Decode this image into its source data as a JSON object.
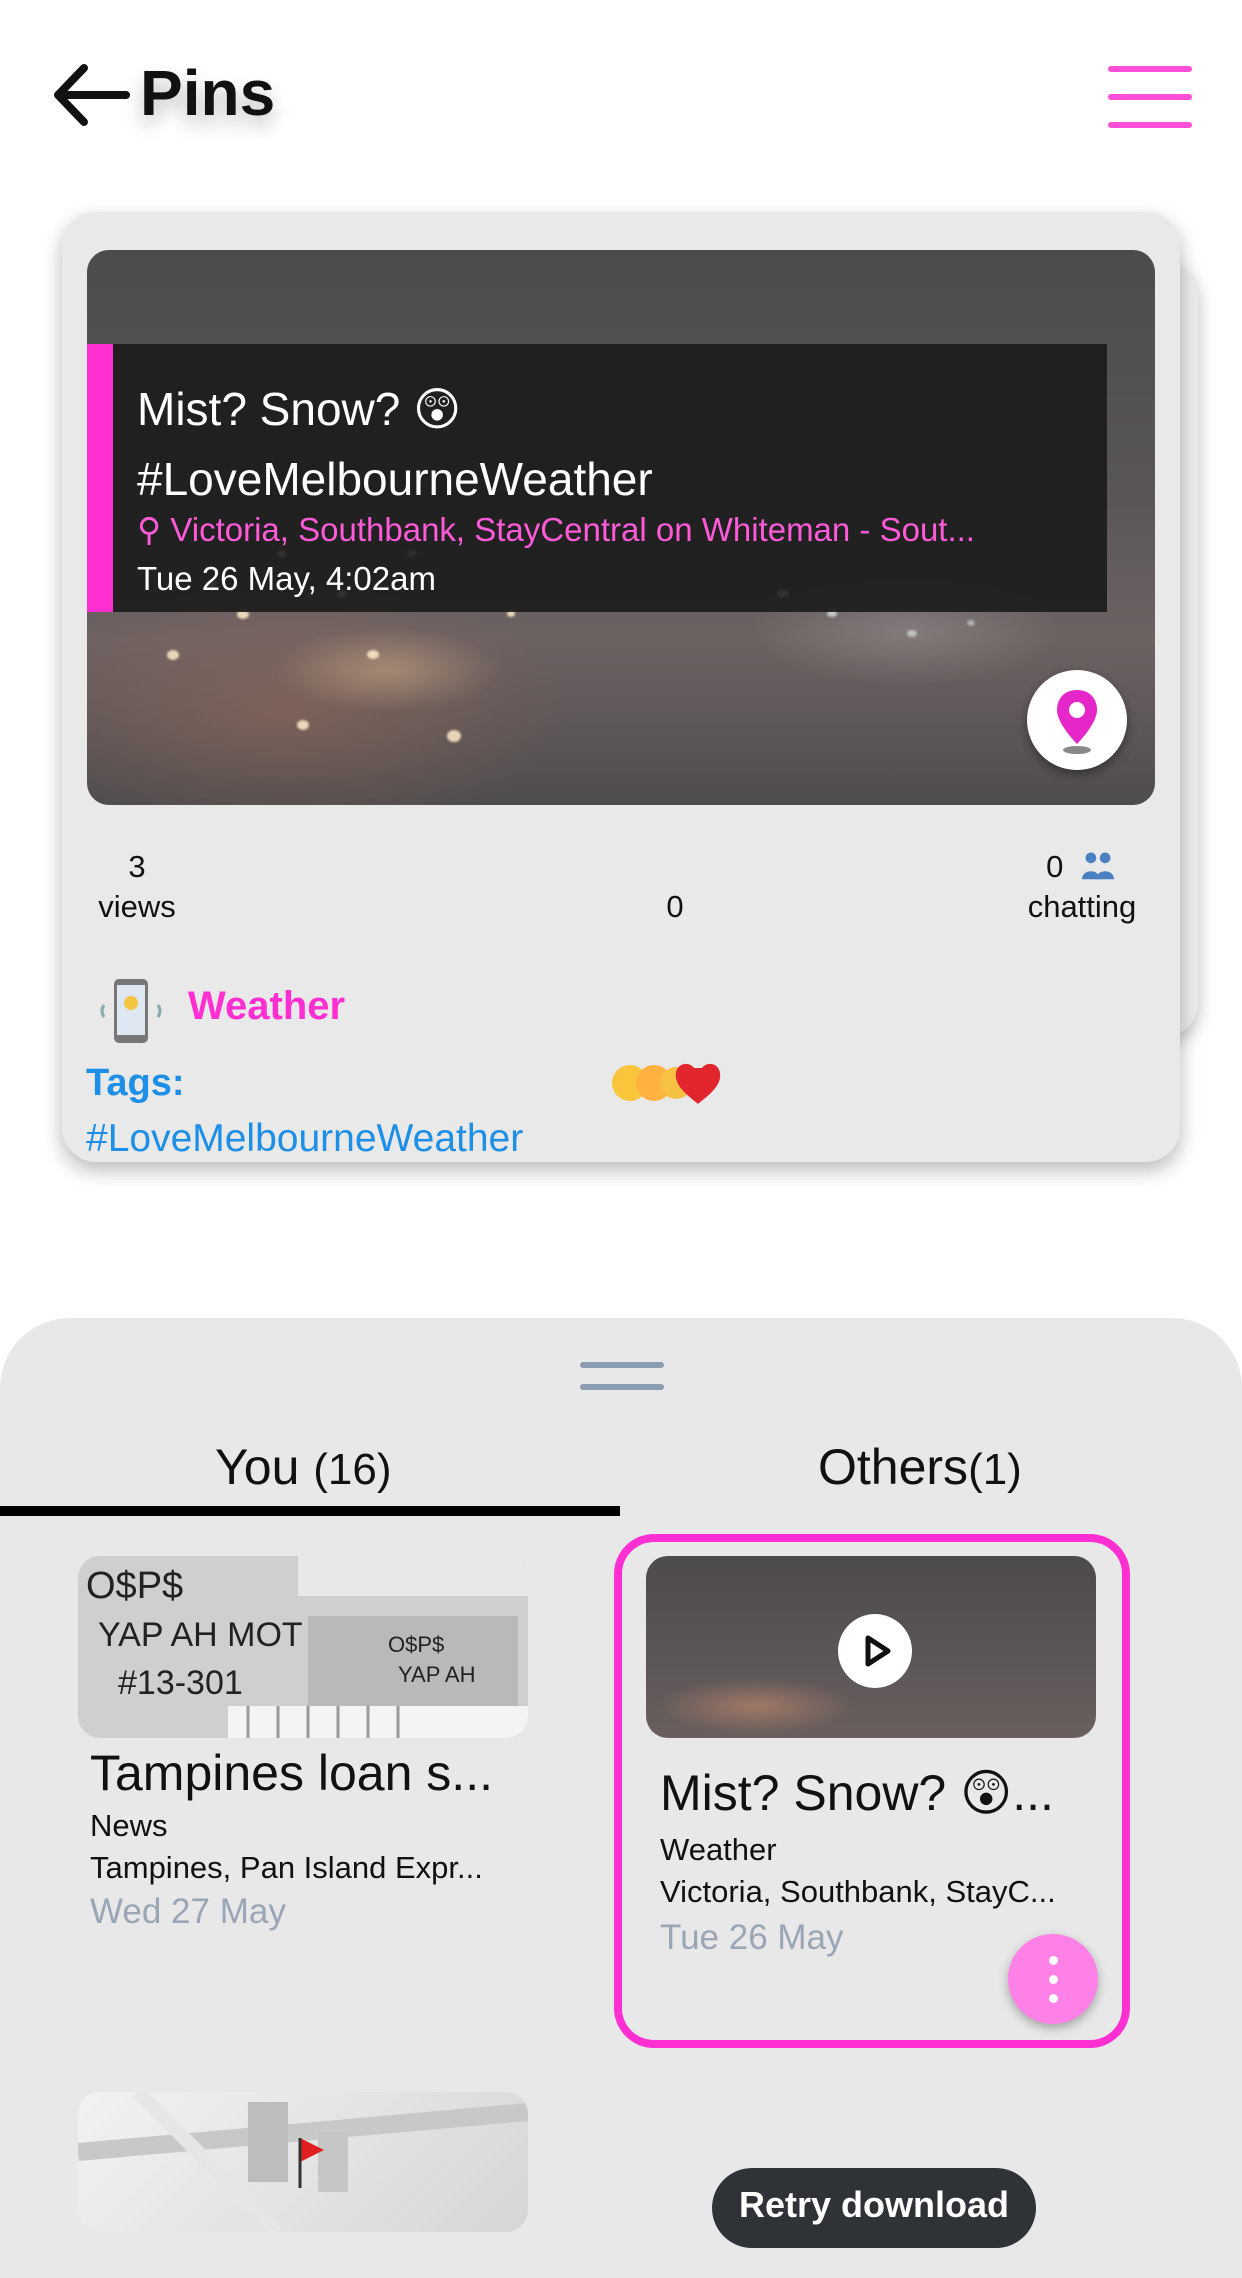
{
  "header": {
    "title": "Pins",
    "back_icon": "arrow-left-icon",
    "menu_icon": "hamburger-menu-icon",
    "accent_color": "#ff2fd2"
  },
  "featured": {
    "title": "Mist? Snow? 😲 #LoveMelbourneWeather",
    "location": "Victoria, Southbank, StayCentral on Whiteman - Sout...",
    "date": "Tue 26 May,  4:02am",
    "views_count": "3",
    "views_label": "views",
    "reactions_count": "0",
    "chatting_count": "0",
    "chatting_label": "chatting",
    "category": "Weather",
    "tags_label": "Tags:",
    "tags": "#LoveMelbourneWeather"
  },
  "sheet": {
    "tabs": [
      {
        "label": "You",
        "count": "(16)",
        "active": true
      },
      {
        "label": "Others",
        "count": "(1)",
        "active": false
      }
    ],
    "items": [
      {
        "title": "Tampines loan s...",
        "category": "News",
        "location": "Tampines, Pan Island Expr...",
        "date": "Wed 27 May"
      },
      {
        "title": "Mist? Snow? 😲...",
        "category": "Weather",
        "location": "Victoria, Southbank, StayC...",
        "date": "Tue 26 May",
        "selected": true
      }
    ],
    "retry_label": "Retry download"
  }
}
